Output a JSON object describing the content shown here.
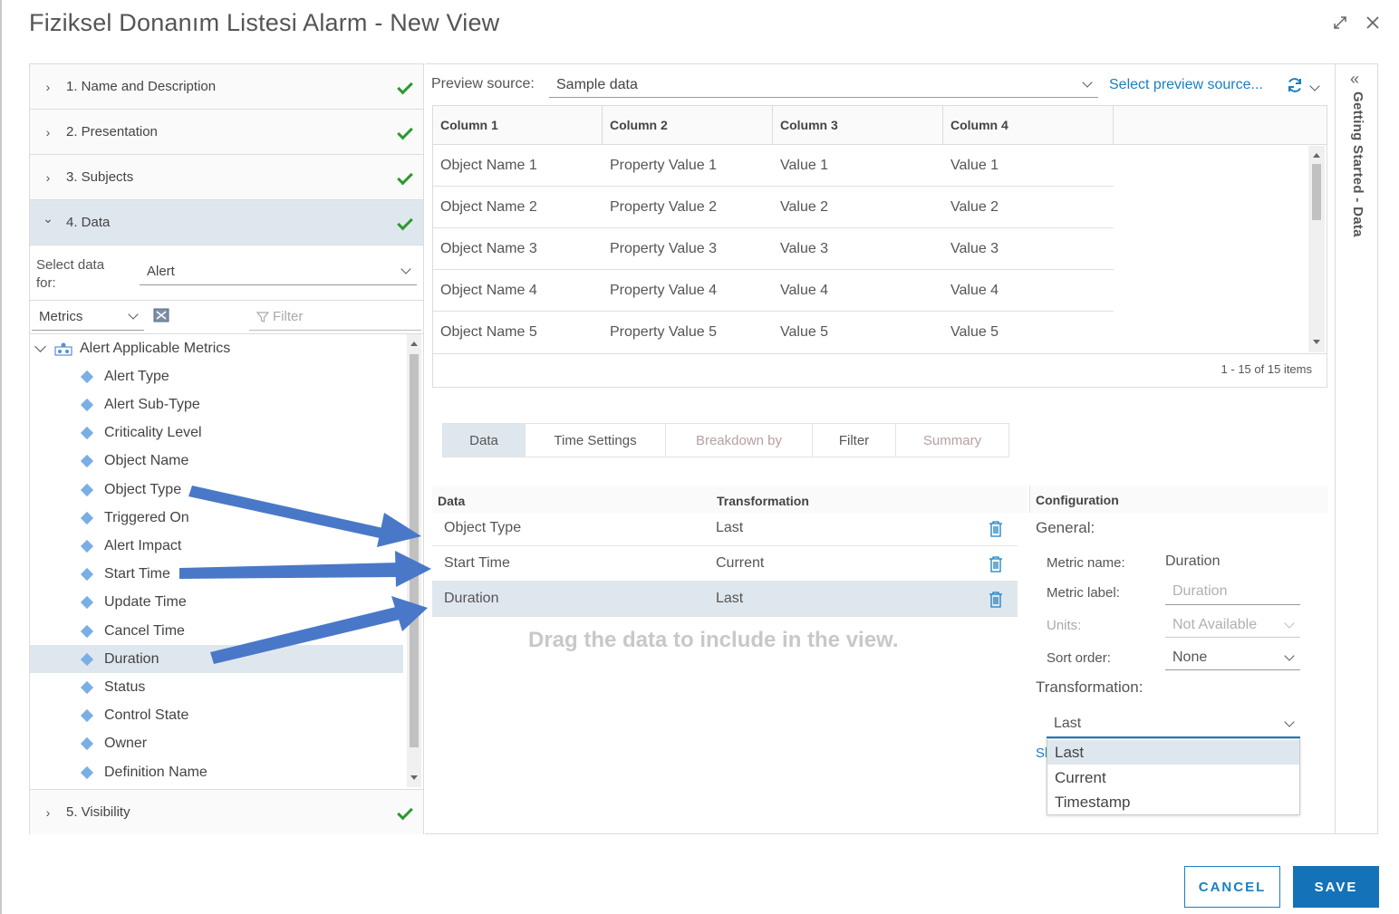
{
  "window": {
    "title": "Fiziksel Donanım Listesi Alarm - New View"
  },
  "steps": [
    {
      "label": "1. Name and Description",
      "chevron": "›",
      "state": "collapsed"
    },
    {
      "label": "2. Presentation",
      "chevron": "›",
      "state": "collapsed"
    },
    {
      "label": "3. Subjects",
      "chevron": "›",
      "state": "collapsed"
    },
    {
      "label": "4. Data",
      "chevron": "⌄",
      "state": "expanded"
    },
    {
      "label": "5. Visibility",
      "chevron": "›",
      "state": "collapsed"
    }
  ],
  "data_step": {
    "select_label": "Select data for:",
    "select_value": "Alert",
    "metrics_value": "Metrics",
    "filter_placeholder": "Filter",
    "tree_root": "Alert Applicable Metrics",
    "tree_items": [
      "Alert Type",
      "Alert Sub-Type",
      "Criticality Level",
      "Object Name",
      "Object Type",
      "Triggered On",
      "Alert Impact",
      "Start Time",
      "Update Time",
      "Cancel Time",
      "Duration",
      "Status",
      "Control State",
      "Owner",
      "Definition Name"
    ],
    "selected_item": "Duration"
  },
  "preview": {
    "label": "Preview source:",
    "value": "Sample data",
    "select_link": "Select preview source...",
    "columns": [
      "Column 1",
      "Column 2",
      "Column 3",
      "Column 4"
    ],
    "rows": [
      [
        "Object Name 1",
        "Property Value 1",
        "Value 1",
        "Value 1"
      ],
      [
        "Object Name 2",
        "Property Value 2",
        "Value 2",
        "Value 2"
      ],
      [
        "Object Name 3",
        "Property Value 3",
        "Value 3",
        "Value 3"
      ],
      [
        "Object Name 4",
        "Property Value 4",
        "Value 4",
        "Value 4"
      ],
      [
        "Object Name 5",
        "Property Value 5",
        "Value 5",
        "Value 5"
      ]
    ],
    "footer": "1 - 15 of 15 items"
  },
  "tabs": [
    {
      "label": "Data",
      "state": "active"
    },
    {
      "label": "Time Settings",
      "state": "normal"
    },
    {
      "label": "Breakdown by",
      "state": "disabled"
    },
    {
      "label": "Filter",
      "state": "normal"
    },
    {
      "label": "Summary",
      "state": "disabled"
    }
  ],
  "data_table": {
    "col_data": "Data",
    "col_transformation": "Transformation",
    "rows": [
      {
        "data": "Object Type",
        "transformation": "Last"
      },
      {
        "data": "Start Time",
        "transformation": "Current"
      },
      {
        "data": "Duration",
        "transformation": "Last"
      }
    ],
    "drag_hint": "Drag the data to include in the view."
  },
  "configuration": {
    "header": "Configuration",
    "general": "General:",
    "metric_name_label": "Metric name:",
    "metric_name_value": "Duration",
    "metric_label_label": "Metric label:",
    "metric_label_placeholder": "Duration",
    "units_label": "Units:",
    "units_value": "Not Available",
    "sort_order_label": "Sort order:",
    "sort_order_value": "None",
    "transformation_label": "Transformation:",
    "transformation_value": "Last",
    "hidden_link_fragment": "Sl",
    "transformation_options": [
      "Last",
      "Current",
      "Timestamp"
    ],
    "highlighted_option": "Last"
  },
  "side_panel": {
    "label": "Getting Started - Data",
    "collapse_glyph": "«"
  },
  "footer": {
    "cancel": "CANCEL",
    "save": "SAVE"
  },
  "colors": {
    "accent": "#1472b8",
    "link": "#1a7fc1",
    "check": "#2a9a2f",
    "selection": "#dfe7ee",
    "arrow": "#4a78c8",
    "diamond": "#7aaee5"
  }
}
